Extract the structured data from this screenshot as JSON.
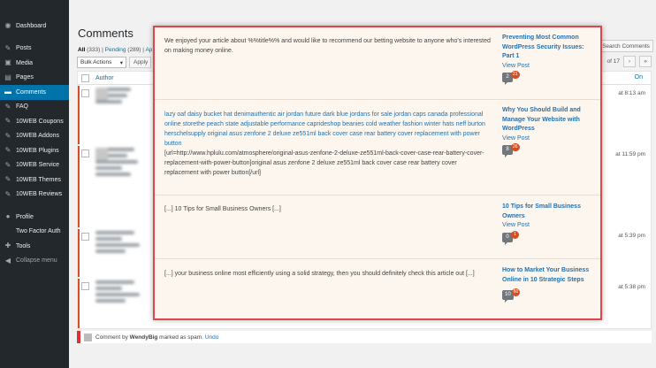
{
  "sidebar": {
    "items": [
      {
        "label": "Dashboard",
        "icon": "dashboard-icon",
        "active": false
      },
      {
        "label": "Posts",
        "icon": "pin-icon",
        "active": false
      },
      {
        "label": "Media",
        "icon": "media-icon",
        "active": false
      },
      {
        "label": "Pages",
        "icon": "pages-icon",
        "active": false
      },
      {
        "label": "Comments",
        "icon": "comment-icon",
        "active": true
      },
      {
        "label": "FAQ",
        "icon": "pin-icon",
        "active": false
      },
      {
        "label": "10WEB Coupons",
        "icon": "pin-icon",
        "active": false
      },
      {
        "label": "10WEB Addons",
        "icon": "pin-icon",
        "active": false
      },
      {
        "label": "10WEB Plugins",
        "icon": "pin-icon",
        "active": false
      },
      {
        "label": "10WEB Service",
        "icon": "pin-icon",
        "active": false
      },
      {
        "label": "10WEB Themes",
        "icon": "pin-icon",
        "active": false
      },
      {
        "label": "10WEB Reviews",
        "icon": "pin-icon",
        "active": false
      },
      {
        "label": "Profile",
        "icon": "user-icon",
        "active": false
      },
      {
        "label": "Two Factor Auth",
        "icon": "blank-icon",
        "active": false
      },
      {
        "label": "Tools",
        "icon": "wrench-icon",
        "active": false
      },
      {
        "label": "Collapse menu",
        "icon": "collapse-icon",
        "active": false
      }
    ]
  },
  "header": {
    "title": "Comments"
  },
  "filters": {
    "all": "All",
    "all_count": "(333)",
    "sep1": " | ",
    "pending": "Pending",
    "pending_count": "(289)",
    "sep2": " | ",
    "approved_short": "Ap"
  },
  "toolbar": {
    "bulk_label": "Bulk Actions",
    "apply_label": "Apply",
    "search_button": "Search Comments",
    "page_of": "of 17"
  },
  "table": {
    "author_header": "Author",
    "on_header": "On",
    "dates": [
      "at 8:13 am",
      "at 11:59 pm",
      "at 5:39 pm",
      "at 5:38 pm"
    ]
  },
  "undo_notice": {
    "prefix": "Comment by",
    "author": "WendyBig",
    "middle": "marked as spam.",
    "undo": "Undo"
  },
  "overlay": {
    "rows": [
      {
        "text": "We enjoyed your article about %%title%% and would like to recommend our betting website to anyone who's interested on making money online.",
        "link_text": "",
        "text_after": "",
        "post_title": "Preventing Most Common WordPress Security Issues: Part 1",
        "view": "View Post",
        "approved": "2",
        "pending": "21"
      },
      {
        "text": "",
        "link_text": "lazy oaf daisy bucket hat denimauthentic air jordan future dark blue jordans for sale jordan caps canada professional online storethe peach state adjustable performance caprideshop beanies cold weather fashion winter hats neff burton herschelsupply original asus zenfone 2 deluxe ze551ml back cover case rear battery cover replacement with power button",
        "text_after": "[url=http://www.hplulu.com/atmosphere/original-asus-zenfone-2-deluxe-ze551ml-back-cover-case-rear-battery-cover-replacement-with-power-button]original asus zenfone 2 deluxe ze551ml back cover case rear battery cover replacement with power button[/url]",
        "post_title": "Why You Should Build and Manage Your Website with WordPress",
        "view": "View Post",
        "approved": "8",
        "pending": "26"
      },
      {
        "text": "[...] 10 Tips for Small Business Owners [...]",
        "link_text": "",
        "text_after": "",
        "post_title": "10 Tips for Small Business Owners",
        "view": "View Post",
        "approved": "0",
        "pending": "1"
      },
      {
        "text": "[...] your business online most efficiently using a solid strategy, then you should definitely check this article out [...]",
        "link_text": "",
        "text_after": "",
        "post_title": "How to Market Your Business Online in 10 Strategic Steps",
        "view": "View Post",
        "approved": "10",
        "pending": "60"
      }
    ]
  },
  "colors": {
    "sidebar_bg": "#23282d",
    "active_menu": "#0073aa",
    "overlay_border": "#e0454b",
    "pending_badge": "#d54e21"
  }
}
